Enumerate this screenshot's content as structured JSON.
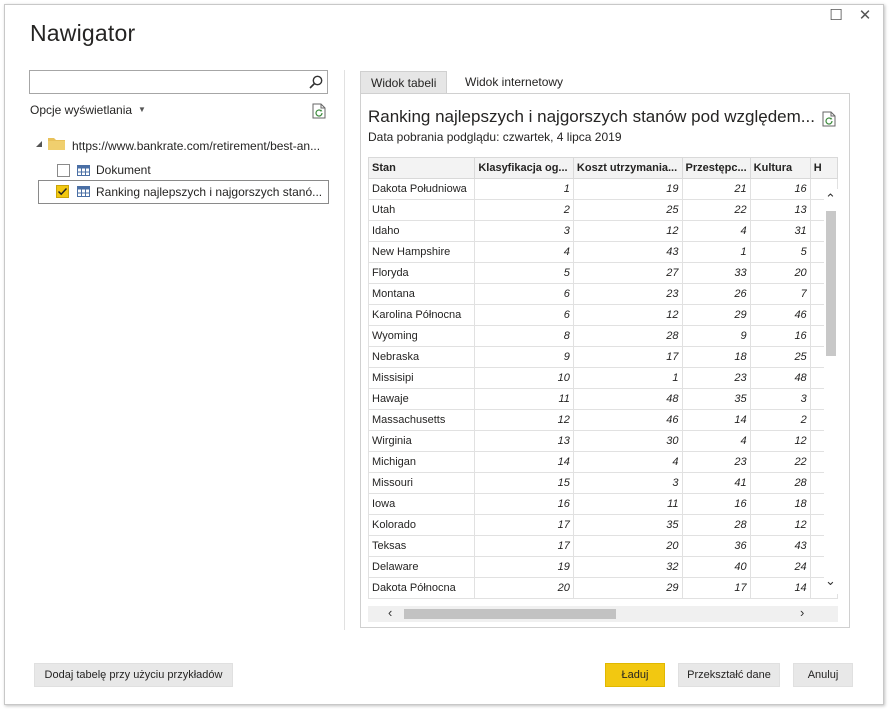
{
  "window": {
    "title": "Nawigator",
    "maximize_glyph": "☐",
    "close_glyph": "✕"
  },
  "left_panel": {
    "search": {
      "value": "",
      "placeholder": ""
    },
    "display_options_label": "Opcje wyświetlania",
    "tree": {
      "root_label": "https://www.bankrate.com/retirement/best-an...",
      "items": [
        {
          "label": "Dokument",
          "checked": false
        },
        {
          "label": "Ranking najlepszych i najgorszych stanó...",
          "checked": true
        }
      ]
    }
  },
  "right_panel": {
    "tabs": [
      {
        "label": "Widok tabeli",
        "active": true
      },
      {
        "label": "Widok internetowy",
        "active": false
      }
    ],
    "preview_title": "Ranking najlepszych i najgorszych stanów pod względem...",
    "preview_subtitle": "Data pobrania podglądu: czwartek, 4 lipca 2019",
    "table": {
      "columns": [
        "Stan",
        "Klasyfikacja og...",
        "Koszt utrzymania...",
        "Przestępc...",
        "Kultura",
        "H"
      ],
      "rows": [
        [
          "Dakota Południowa",
          "1",
          "19",
          "21",
          "16"
        ],
        [
          "Utah",
          "2",
          "25",
          "22",
          "13"
        ],
        [
          "Idaho",
          "3",
          "12",
          "4",
          "31"
        ],
        [
          "New Hampshire",
          "4",
          "43",
          "1",
          "5"
        ],
        [
          "Floryda",
          "5",
          "27",
          "33",
          "20"
        ],
        [
          "Montana",
          "6",
          "23",
          "26",
          "7"
        ],
        [
          "Karolina Północna",
          "6",
          "12",
          "29",
          "46"
        ],
        [
          "Wyoming",
          "8",
          "28",
          "9",
          "16"
        ],
        [
          "Nebraska",
          "9",
          "17",
          "18",
          "25"
        ],
        [
          "Missisipi",
          "10",
          "1",
          "23",
          "48"
        ],
        [
          "Hawaje",
          "11",
          "48",
          "35",
          "3"
        ],
        [
          "Massachusetts",
          "12",
          "46",
          "14",
          "2"
        ],
        [
          "Wirginia",
          "13",
          "30",
          "4",
          "12"
        ],
        [
          "Michigan",
          "14",
          "4",
          "23",
          "22"
        ],
        [
          "Missouri",
          "15",
          "3",
          "41",
          "28"
        ],
        [
          "Iowa",
          "16",
          "11",
          "16",
          "18"
        ],
        [
          "Kolorado",
          "17",
          "35",
          "28",
          "12"
        ],
        [
          "Teksas",
          "17",
          "20",
          "36",
          "43"
        ],
        [
          "Delaware",
          "19",
          "32",
          "40",
          "24"
        ],
        [
          "Dakota Północna",
          "20",
          "29",
          "17",
          "14"
        ]
      ]
    }
  },
  "footer": {
    "add_table_label": "Dodaj tabelę przy użyciu przykładów",
    "load_label": "Ładuj",
    "transform_label": "Przekształć dane",
    "cancel_label": "Anuluj"
  },
  "colors": {
    "accent_yellow": "#F2C811",
    "folder_yellow": "#E8C15A",
    "table_icon_blue": "#4A6FA5"
  },
  "icons": [
    "search-icon",
    "chevron-down-icon",
    "refresh-icon",
    "folder-icon",
    "table-icon",
    "checkbox-icon",
    "scroll-up-icon",
    "scroll-down-icon",
    "scroll-left-icon",
    "scroll-right-icon",
    "maximize-icon",
    "close-icon"
  ]
}
